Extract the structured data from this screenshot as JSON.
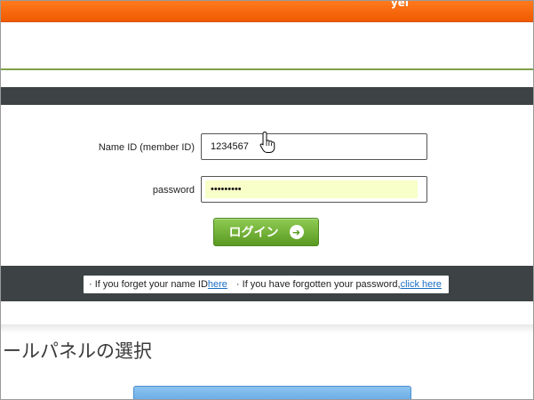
{
  "banner": {
    "brand_text": "yei"
  },
  "login_form": {
    "name_label": "Name ID (member ID)",
    "name_value": "1234567",
    "password_label": "password",
    "password_value": "•••••••••",
    "login_button_label": "ログイン"
  },
  "help": {
    "forgot_name_prefix": "· If you forget your name ID ",
    "forgot_name_link": "here",
    "forgot_password_prefix": "· If you have forgotten your password, ",
    "forgot_password_link": "click here"
  },
  "section": {
    "heading": "ールパネルの選択"
  },
  "colors": {
    "banner_orange": "#f05a00",
    "dark_bar": "#3d4245",
    "login_green": "#5a9a22",
    "link_blue": "#1a6fc4",
    "password_autofill": "#f8ffc8"
  }
}
